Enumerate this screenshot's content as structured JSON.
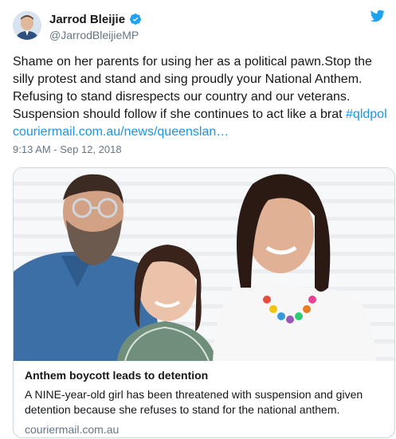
{
  "author": {
    "display_name": "Jarrod Bleijie",
    "handle": "@JarrodBleijieMP",
    "verified_icon": "verified-badge-icon"
  },
  "tweet": {
    "text": "Shame on her parents for using her as a political pawn.Stop the silly protest and stand and sing proudly your National Anthem. Refusing to stand disrespects our country and our veterans. Suspension should follow if she continues to act like a brat ",
    "hashtag": "#qldpol",
    "link": "couriermail.com.au/news/queenslan…",
    "timestamp": "9:13 AM - Sep 12, 2018"
  },
  "card": {
    "title": "Anthem boycott leads to detention",
    "description": "A NINE-year-old girl has been threatened with suspension and given detention because she refuses to stand for the national anthem.",
    "domain": "couriermail.com.au"
  },
  "colors": {
    "link": "#1b95e0",
    "secondary_text": "#657786",
    "card_border": "#ccd6dd"
  }
}
